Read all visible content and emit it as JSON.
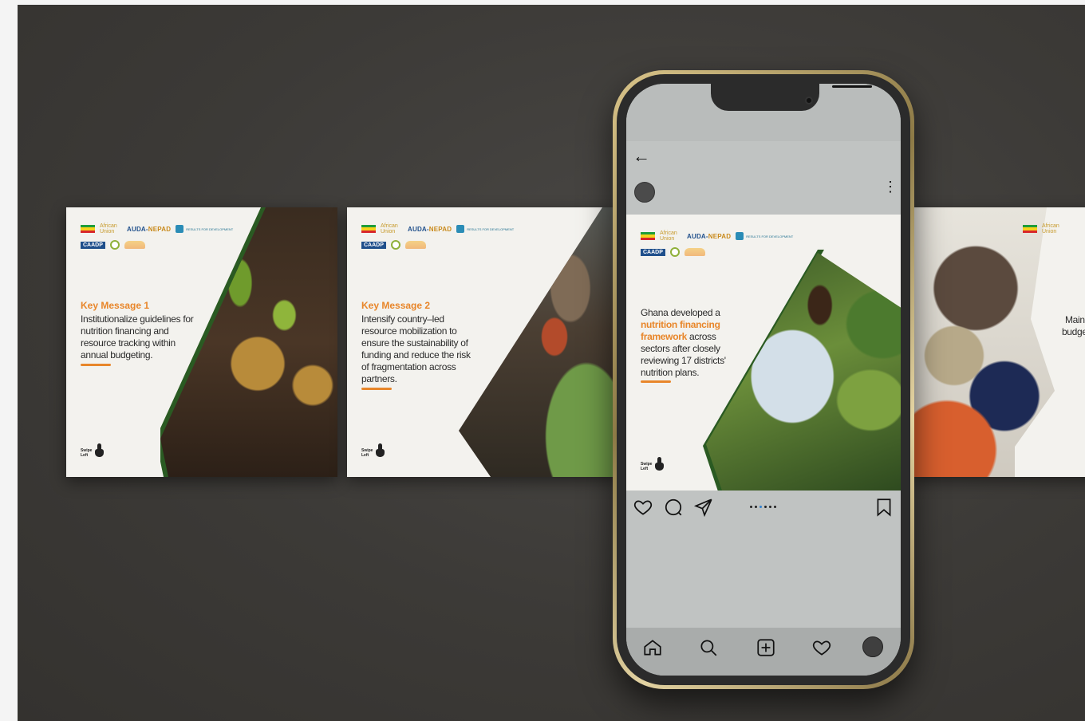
{
  "logos": {
    "african_union": "African Union",
    "auda_prefix": "AUDA-",
    "auda_suffix": "NEPAD",
    "r4d": "RESULTS FOR DEVELOPMENT",
    "caadp": "CAADP"
  },
  "swipe": {
    "label_line1": "Swipe",
    "label_line2": "Left"
  },
  "cards": [
    {
      "title": "Key Message 1",
      "body": "Institutionalize guidelines for nutrition financing and resource tracking within annual budgeting."
    },
    {
      "title": "Key Message 2",
      "body": "Intensify country–led resource mobilization to ensure the sustainability of funding and reduce the risk of fragmentation across partners."
    }
  ],
  "partial_card": {
    "text": "Mainstr na budge p go"
  },
  "post": {
    "text_before": "Ghana developed a ",
    "highlight": "nutrition financing framework",
    "text_after": " across sectors after closely reviewing 17 districts' nutrition plans."
  },
  "carousel": {
    "count": 6,
    "active_index": 2
  },
  "icons": {
    "back": "←",
    "more": "⋮"
  },
  "colors": {
    "accent_orange": "#e8862a",
    "forest_green": "#2a5a22",
    "auda_blue": "#1f4f8b",
    "active_dot": "#2f7fcf"
  }
}
